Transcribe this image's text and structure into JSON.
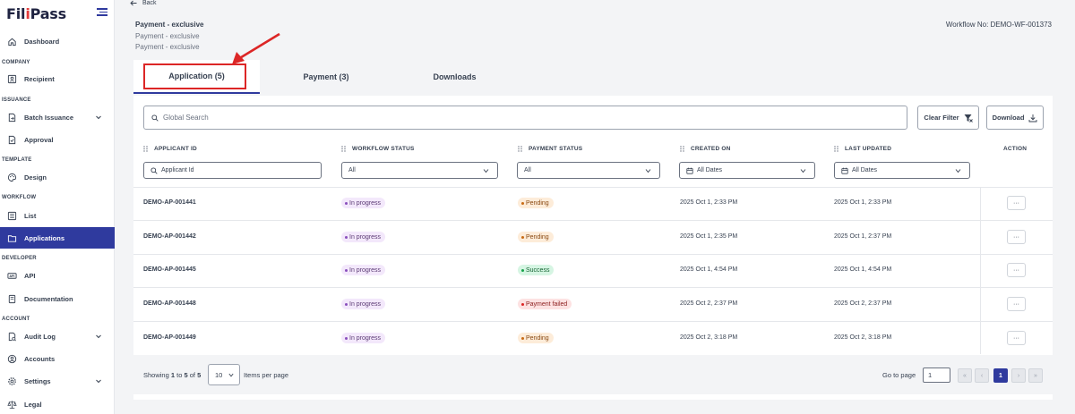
{
  "app": {
    "logo_pre": "Fil",
    "logo_accent": "i",
    "logo_post": "Pass"
  },
  "sidebar": {
    "sections": [
      "COMPANY",
      "ISSUANCE",
      "TEMPLATE",
      "WORKFLOW",
      "DEVELOPER",
      "ACCOUNT"
    ],
    "items": [
      {
        "label": "Dashboard",
        "icon": "home-icon"
      },
      {
        "label": "Recipient",
        "icon": "contact-icon"
      },
      {
        "label": "Batch Issuance",
        "icon": "document-icon"
      },
      {
        "label": "Approval",
        "icon": "approval-icon"
      },
      {
        "label": "Design",
        "icon": "palette-icon"
      },
      {
        "label": "List",
        "icon": "list-icon"
      },
      {
        "label": "Applications",
        "icon": "folder-icon"
      },
      {
        "label": "API",
        "icon": "api-icon"
      },
      {
        "label": "Documentation",
        "icon": "book-icon"
      },
      {
        "label": "Audit Log",
        "icon": "audit-icon"
      },
      {
        "label": "Accounts",
        "icon": "user-circle-icon"
      },
      {
        "label": "Settings",
        "icon": "gear-icon"
      },
      {
        "label": "Legal",
        "icon": "scale-icon"
      }
    ]
  },
  "header": {
    "back": "Back",
    "title": "Payment - exclusive",
    "sub1": "Payment - exclusive",
    "sub2": "Payment - exclusive",
    "workflow_no": "Workflow No: DEMO-WF-001373"
  },
  "tabs": [
    {
      "label": "Application (5)",
      "active": true
    },
    {
      "label": "Payment (3)",
      "active": false
    },
    {
      "label": "Downloads",
      "active": false
    }
  ],
  "toolbar": {
    "search_placeholder": "Global Search",
    "clear_filter": "Clear Filter",
    "download": "Download"
  },
  "table": {
    "columns": [
      "APPLICANT ID",
      "WORKFLOW STATUS",
      "PAYMENT STATUS",
      "CREATED ON",
      "LAST UPDATED",
      "ACTION"
    ],
    "filters": {
      "applicant_placeholder": "Applicant Id",
      "workflow": "All",
      "payment": "All",
      "created": "All Dates",
      "updated": "All Dates"
    },
    "rows": [
      {
        "id": "DEMO-AP-001441",
        "workflow": "In progress",
        "payment": "Pending",
        "payment_kind": "pending",
        "created": "2025 Oct 1, 2:33 PM",
        "updated": "2025 Oct 1, 2:33 PM",
        "action": "···"
      },
      {
        "id": "DEMO-AP-001442",
        "workflow": "In progress",
        "payment": "Pending",
        "payment_kind": "pending",
        "created": "2025 Oct 1, 2:35 PM",
        "updated": "2025 Oct 1, 2:37 PM",
        "action": "···"
      },
      {
        "id": "DEMO-AP-001445",
        "workflow": "In progress",
        "payment": "Success",
        "payment_kind": "success",
        "created": "2025 Oct 1, 4:54 PM",
        "updated": "2025 Oct 1, 4:54 PM",
        "action": "···"
      },
      {
        "id": "DEMO-AP-001448",
        "workflow": "In progress",
        "payment": "Payment failed",
        "payment_kind": "failed",
        "created": "2025 Oct 2, 2:37 PM",
        "updated": "2025 Oct 2, 2:37 PM",
        "action": "···"
      },
      {
        "id": "DEMO-AP-001449",
        "workflow": "In progress",
        "payment": "Pending",
        "payment_kind": "pending",
        "created": "2025 Oct 2, 3:18 PM",
        "updated": "2025 Oct 2, 3:18 PM",
        "action": "···"
      }
    ]
  },
  "pagination": {
    "showing_pre": "Showing ",
    "from": "1",
    "to_word": " to ",
    "to": "5",
    "of_word": " of ",
    "total": "5",
    "per_page": "10",
    "items_per_page": "Items per page",
    "go_to_page": "Go to page",
    "page_input": "1",
    "first": "«",
    "prev": "‹",
    "current": "1",
    "next": "›",
    "last": "»"
  },
  "colors": {
    "primary": "#2f3a9e",
    "highlight": "#dc2626"
  }
}
